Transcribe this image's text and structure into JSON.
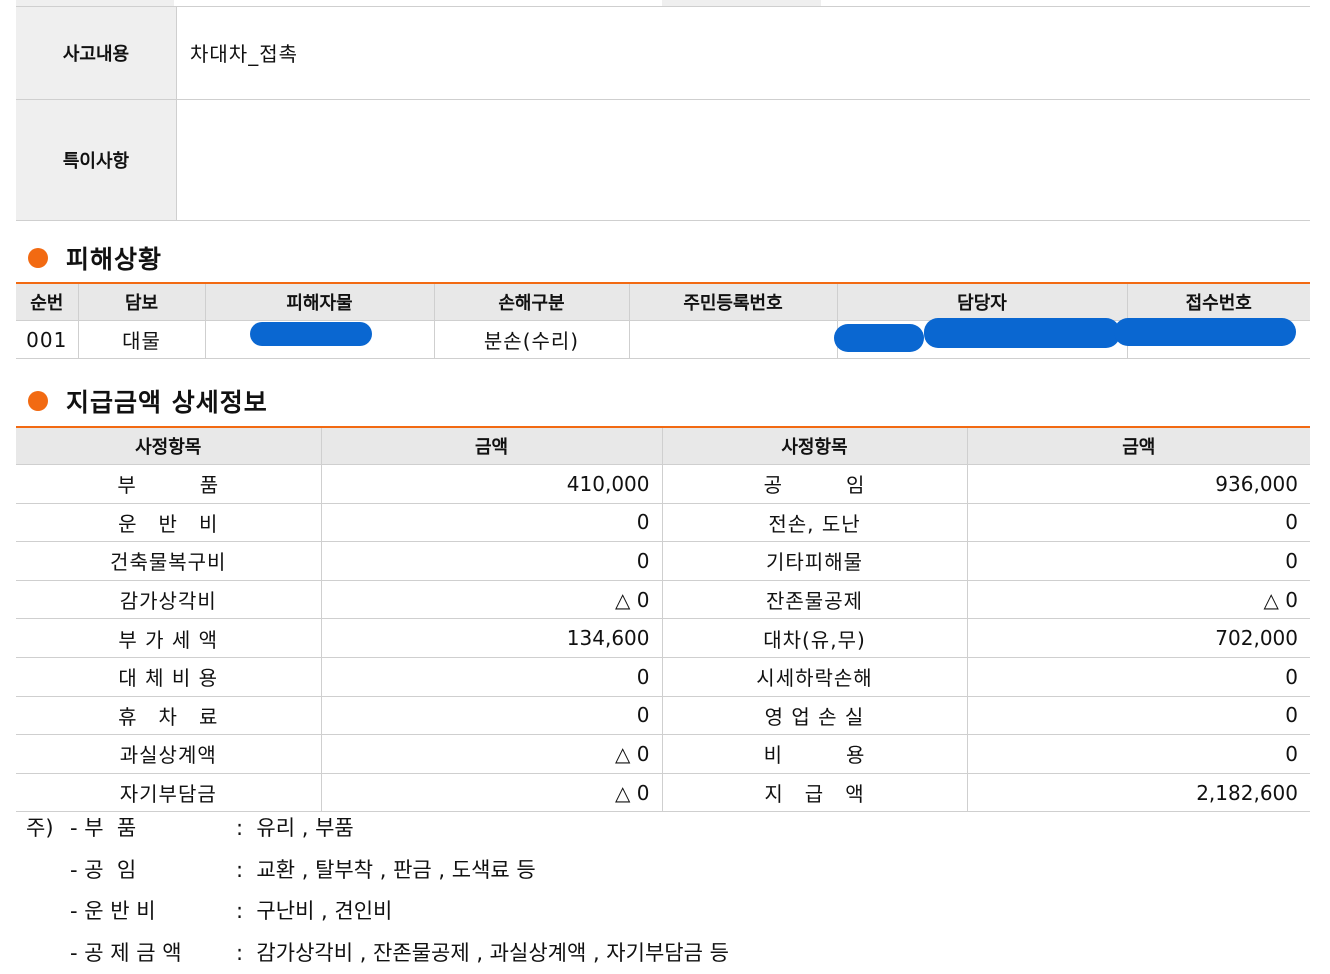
{
  "accident": {
    "label_content": "사고내용",
    "content": "차대차_접촉",
    "label_special": "특이사항",
    "special": ""
  },
  "damage": {
    "title": "피해상황",
    "headers": [
      "순번",
      "담보",
      "피해자물",
      "손해구분",
      "주민등록번호",
      "담당자",
      "접수번호"
    ],
    "row": [
      "001",
      "대물",
      "",
      "분손(수리)",
      "",
      "",
      ""
    ]
  },
  "payment": {
    "title": "지급금액 상세정보",
    "headers": [
      "사정항목",
      "금액",
      "사정항목",
      "금액"
    ],
    "rows": [
      [
        "부　　　품",
        "410,000",
        "공　　　임",
        "936,000"
      ],
      [
        "운　반　비",
        "0",
        "전손, 도난",
        "0"
      ],
      [
        "건축물복구비",
        "0",
        "기타피해물",
        "0"
      ],
      [
        "감가상각비",
        "△ 0",
        "잔존물공제",
        "△ 0"
      ],
      [
        "부 가 세 액",
        "134,600",
        "대차(유,무)",
        "702,000"
      ],
      [
        "대 체 비 용",
        "0",
        "시세하락손해",
        "0"
      ],
      [
        "휴　차　료",
        "0",
        "영 업 손 실",
        "0"
      ],
      [
        "과실상계액",
        "△ 0",
        "비　　　용",
        "0"
      ],
      [
        "자기부담금",
        "△ 0",
        "지　급　액",
        "2,182,600"
      ]
    ]
  },
  "notes": [
    {
      "prefix": "주)",
      "term": "- 부  품",
      "desc": ":  유리 , 부품"
    },
    {
      "prefix": "",
      "term": "- 공  임",
      "desc": ":  교환 , 탈부착 , 판금 , 도색료 등"
    },
    {
      "prefix": "",
      "term": "- 운 반 비",
      "desc": ":  구난비 , 견인비"
    },
    {
      "prefix": "",
      "term": "- 공 제 금 액",
      "desc": ":  감가상각비 , 잔존물공제 , 과실상계액 , 자기부담금 등"
    }
  ],
  "colors": {
    "accent": "#f26a12",
    "header_bg": "#e8e8e8",
    "redaction": "#0a67d1"
  }
}
